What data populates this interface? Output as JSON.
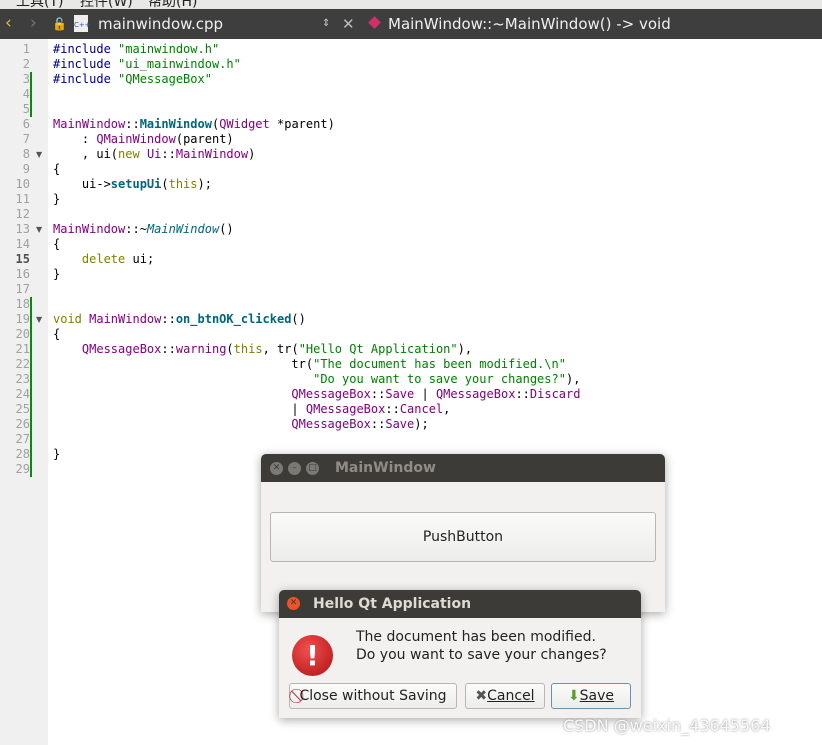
{
  "menubar": {
    "items": [
      "工具(T)",
      "控件(W)",
      "帮助(H)"
    ]
  },
  "toolbar": {
    "file": "mainwindow.cpp",
    "symbol": "MainWindow::~MainWindow() -> void"
  },
  "editor": {
    "current_line": 15,
    "lines": [
      [
        [
          "#include ",
          "pp"
        ],
        [
          "\"mainwindow.h\"",
          "str"
        ]
      ],
      [
        [
          "#include ",
          "pp"
        ],
        [
          "\"ui_mainwindow.h\"",
          "str"
        ]
      ],
      [
        [
          "#include ",
          "pp"
        ],
        [
          "\"QMessageBox\"",
          "str"
        ]
      ],
      [],
      [],
      [
        [
          "MainWindow",
          "ty"
        ],
        [
          "::",
          "tx"
        ],
        [
          "MainWindow",
          "fn"
        ],
        [
          "(",
          "tx"
        ],
        [
          "QWidget",
          "ty"
        ],
        [
          " *parent)",
          "tx"
        ]
      ],
      [
        [
          "    : ",
          "tx"
        ],
        [
          "QMainWindow",
          "ty"
        ],
        [
          "(parent)",
          "tx"
        ]
      ],
      [
        [
          "    , ui(",
          "tx"
        ],
        [
          "new ",
          "kw"
        ],
        [
          "Ui",
          "ty"
        ],
        [
          "::",
          "tx"
        ],
        [
          "MainWindow",
          "ty"
        ],
        [
          ")",
          "tx"
        ]
      ],
      [
        [
          "{",
          "tx"
        ]
      ],
      [
        [
          "    ui->",
          "tx"
        ],
        [
          "setupUi",
          "fn"
        ],
        [
          "(",
          "tx"
        ],
        [
          "this",
          "kw"
        ],
        [
          ");",
          "tx"
        ]
      ],
      [
        [
          "}",
          "tx"
        ]
      ],
      [],
      [
        [
          "MainWindow",
          "ty"
        ],
        [
          "::~",
          "tx"
        ],
        [
          "MainWindow",
          "it"
        ],
        [
          "()",
          "tx"
        ]
      ],
      [
        [
          "{",
          "tx"
        ]
      ],
      [
        [
          "    ",
          "tx"
        ],
        [
          "delete",
          "kw"
        ],
        [
          " ui;",
          "tx"
        ]
      ],
      [
        [
          "}",
          "tx"
        ]
      ],
      [],
      [],
      [
        [
          "void ",
          "kw"
        ],
        [
          "MainWindow",
          "ty"
        ],
        [
          "::",
          "tx"
        ],
        [
          "on_btnOK_clicked",
          "fn"
        ],
        [
          "()",
          "tx"
        ]
      ],
      [
        [
          "{",
          "tx"
        ]
      ],
      [
        [
          "    ",
          "tx"
        ],
        [
          "QMessageBox",
          "ty"
        ],
        [
          "::",
          "tx"
        ],
        [
          "warning",
          "ty"
        ],
        [
          "(",
          "tx"
        ],
        [
          "this",
          "kw"
        ],
        [
          ", tr(",
          "tx"
        ],
        [
          "\"Hello Qt Application\"",
          "str"
        ],
        [
          "),",
          "tx"
        ]
      ],
      [
        [
          "                                 tr(",
          "tx"
        ],
        [
          "\"The document has been modified.\\n\"",
          "str"
        ]
      ],
      [
        [
          "                                    ",
          "tx"
        ],
        [
          "\"Do you want to save your changes?\"",
          "str"
        ],
        [
          "),",
          "tx"
        ]
      ],
      [
        [
          "                                 ",
          "tx"
        ],
        [
          "QMessageBox",
          "ty"
        ],
        [
          "::",
          "tx"
        ],
        [
          "Save",
          "ty"
        ],
        [
          " | ",
          "tx"
        ],
        [
          "QMessageBox",
          "ty"
        ],
        [
          "::",
          "tx"
        ],
        [
          "Discard",
          "ty"
        ]
      ],
      [
        [
          "                                 | ",
          "tx"
        ],
        [
          "QMessageBox",
          "ty"
        ],
        [
          "::",
          "tx"
        ],
        [
          "Cancel",
          "ty"
        ],
        [
          ",",
          "tx"
        ]
      ],
      [
        [
          "                                 ",
          "tx"
        ],
        [
          "QMessageBox",
          "ty"
        ],
        [
          "::",
          "tx"
        ],
        [
          "Save",
          "ty"
        ],
        [
          ");",
          "tx"
        ]
      ],
      [],
      [
        [
          "}",
          "tx"
        ]
      ],
      []
    ]
  },
  "main_window": {
    "title": "MainWindow",
    "button": "PushButton"
  },
  "dialog": {
    "title": "Hello Qt Application",
    "line1": "The document has been modified.",
    "line2": "Do you want to save your changes?",
    "discard": "Close without Saving",
    "cancel": "Cancel",
    "save": "Save"
  },
  "watermark": "CSDN @weixin_43645564"
}
